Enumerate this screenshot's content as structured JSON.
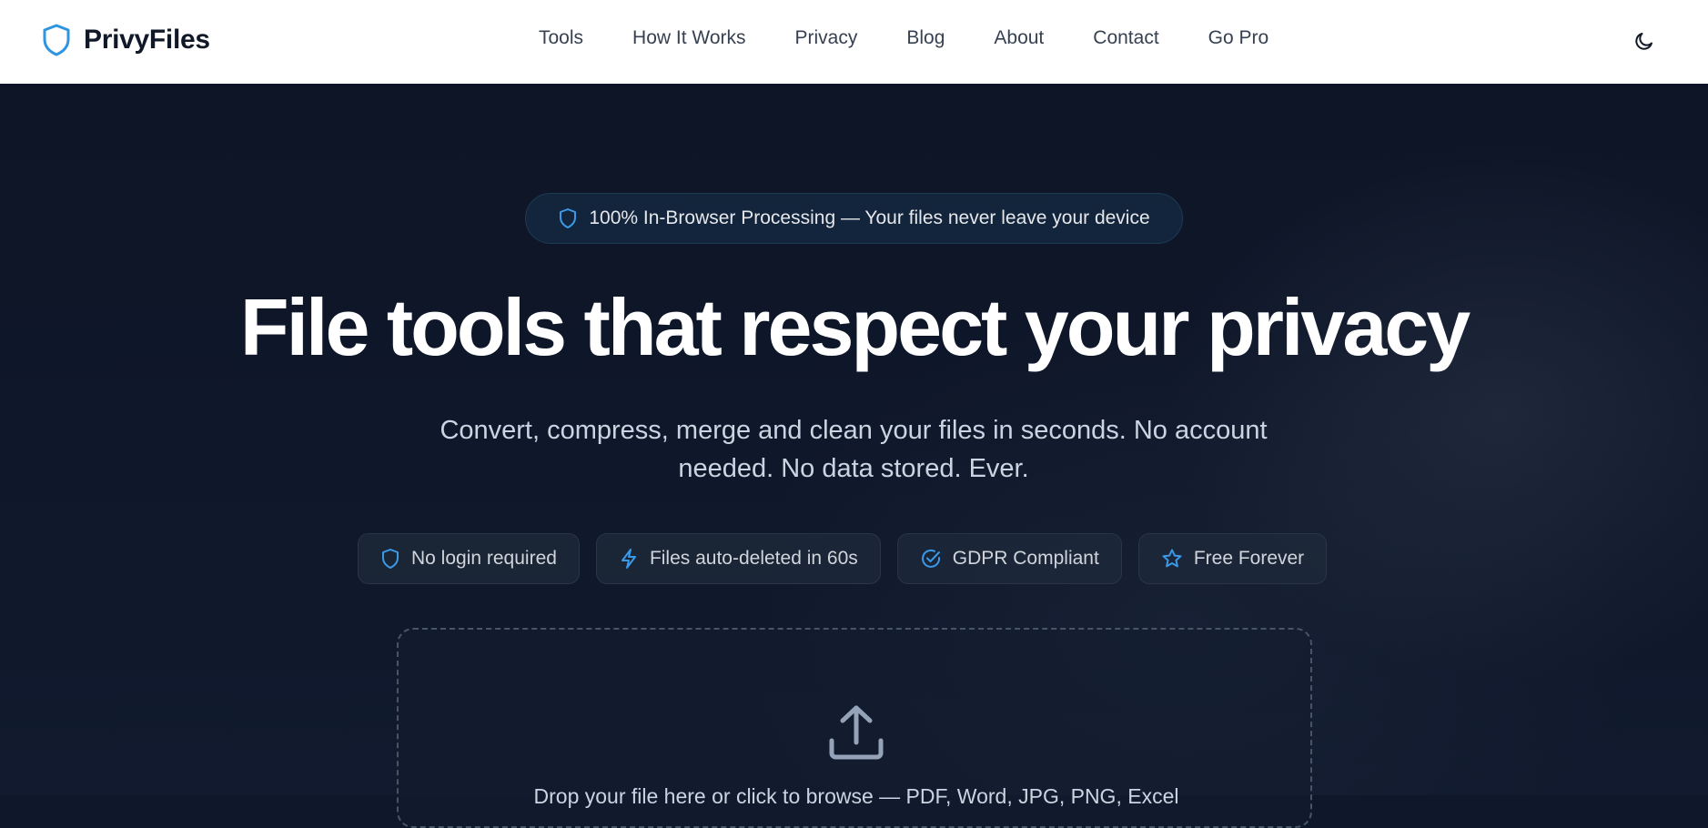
{
  "brand": {
    "name": "PrivyFiles",
    "accent": "#3b9ae8"
  },
  "nav": {
    "items": [
      "Tools",
      "How It Works",
      "Privacy",
      "Blog",
      "About",
      "Contact",
      "Go Pro"
    ]
  },
  "theme_toggle": {
    "icon": "moon-icon"
  },
  "hero": {
    "pill_text": "100% In-Browser Processing — Your files never leave your device",
    "headline": "File tools that respect your privacy",
    "subhead": "Convert, compress, merge and clean your files in seconds. No account needed. No data stored. Ever.",
    "badges": [
      {
        "label": "No login required",
        "icon": "shield-icon"
      },
      {
        "label": "Files auto-deleted in 60s",
        "icon": "lightning-icon"
      },
      {
        "label": "GDPR Compliant",
        "icon": "check-circle-icon"
      },
      {
        "label": "Free Forever",
        "icon": "star-icon"
      }
    ],
    "dropzone": {
      "icon": "upload-icon",
      "text": "Drop your file here or click to browse — PDF, Word, JPG, PNG, Excel"
    }
  }
}
